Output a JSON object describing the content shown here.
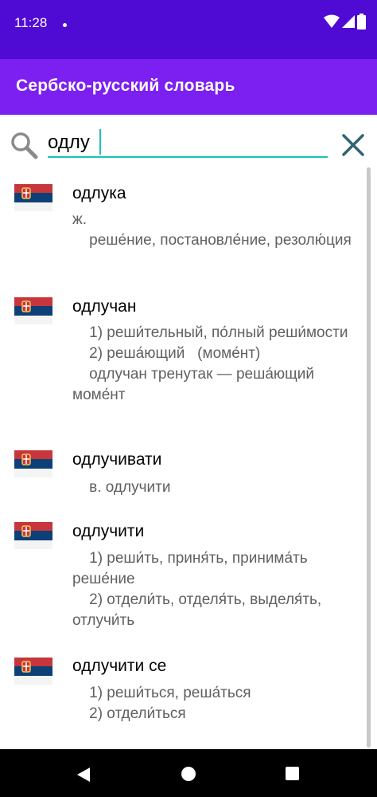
{
  "status_bar": {
    "time": "11:28"
  },
  "app_bar": {
    "title": "Сербско-русский словарь"
  },
  "search": {
    "value": "одлу"
  },
  "entries": [
    {
      "word": "одлука",
      "definition": "ж.\n    реше́ние, постановле́ние, резолю́ция"
    },
    {
      "word": "одлучан",
      "definition": "    1) реши́тельный, по́лный реши́мости\n    2) реша́ющий   (моме́нт)\n    одлучан тренутак — реша́ющий моме́нт"
    },
    {
      "word": "одлучивати",
      "definition": "    в. одлучити"
    },
    {
      "word": "одлучити",
      "definition": "    1) реши́ть, приня́ть, принима́ть реше́ние\n    2) отдели́ть, отделя́ть, выделя́ть, отлучи́ть"
    },
    {
      "word": "одлучити се",
      "definition": "    1) реши́ться, реша́ться\n    2) отдели́ться"
    }
  ],
  "colors": {
    "status_bar": "#4f0ad3",
    "app_bar": "#7c1ff1",
    "accent": "#19c3b4",
    "clear_icon": "#2f6472"
  },
  "icons": {
    "search": "search-icon",
    "clear": "close-icon",
    "flag": "serbian-flag-icon"
  }
}
